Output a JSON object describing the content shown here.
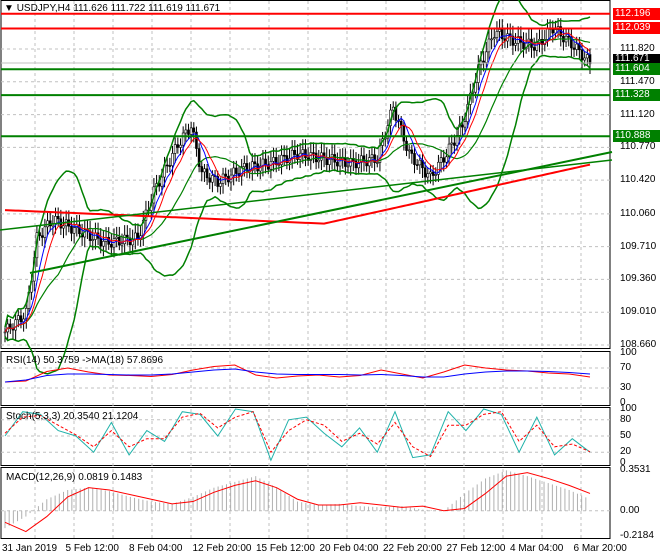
{
  "header": {
    "symbol": "USDJPY,H4",
    "ohlc": "111.626 111.722 111.619 111.671"
  },
  "price_axis": [
    "111.820",
    "111.470",
    "111.120",
    "110.770",
    "110.420",
    "110.060",
    "109.710",
    "109.360",
    "109.010",
    "108.660"
  ],
  "levels": [
    {
      "label": "112.196",
      "value": 112.196,
      "color": "#ff0000"
    },
    {
      "label": "112.039",
      "value": 112.039,
      "color": "#ff0000"
    },
    {
      "label": "111.604",
      "value": 111.604,
      "color": "#008000"
    },
    {
      "label": "111.328",
      "value": 111.328,
      "color": "#008000"
    },
    {
      "label": "110.888",
      "value": 110.888,
      "color": "#008000"
    }
  ],
  "current_price": {
    "label": "111.671",
    "value": 111.671
  },
  "rsi": {
    "title": "RSI(14) 50.3759  ->MA(18) 57.8696",
    "axis": [
      "100",
      "70",
      "30",
      "0"
    ]
  },
  "stoch": {
    "title": "Stoch(5,3,3) 20.3540 21.1204",
    "axis": [
      "100",
      "80",
      "50",
      "20",
      "0"
    ]
  },
  "macd": {
    "title": "MACD(12,26,9) 0.0819 0.1483",
    "axis": [
      "0.3531",
      "0.00",
      "-0.2184"
    ]
  },
  "dates": [
    "31 Jan 2019",
    "5 Feb 12:00",
    "8 Feb 04:00",
    "12 Feb 20:00",
    "15 Feb 12:00",
    "20 Feb 04:00",
    "22 Feb 20:00",
    "27 Feb 12:00",
    "4 Mar 04:00",
    "6 Mar 20:00"
  ],
  "chart_data": {
    "type": "candlestick",
    "price_keypoints": [
      [
        0,
        108.8
      ],
      [
        8,
        109.0
      ],
      [
        12,
        109.8
      ],
      [
        18,
        110.0
      ],
      [
        30,
        109.85
      ],
      [
        38,
        109.75
      ],
      [
        50,
        109.8
      ],
      [
        56,
        110.3
      ],
      [
        65,
        110.8
      ],
      [
        70,
        111.0
      ],
      [
        74,
        110.5
      ],
      [
        80,
        110.4
      ],
      [
        90,
        110.55
      ],
      [
        100,
        110.6
      ],
      [
        110,
        110.7
      ],
      [
        120,
        110.65
      ],
      [
        130,
        110.6
      ],
      [
        140,
        110.65
      ],
      [
        146,
        111.2
      ],
      [
        152,
        110.7
      ],
      [
        160,
        110.45
      ],
      [
        166,
        110.7
      ],
      [
        172,
        111.0
      ],
      [
        178,
        111.6
      ],
      [
        184,
        112.0
      ],
      [
        192,
        111.9
      ],
      [
        200,
        111.85
      ],
      [
        206,
        112.05
      ],
      [
        214,
        111.85
      ],
      [
        220,
        111.671
      ]
    ],
    "rsi": [
      42,
      44,
      63,
      70,
      62,
      56,
      55,
      53,
      57,
      66,
      73,
      76,
      56,
      50,
      54,
      56,
      52,
      55,
      66,
      58,
      50,
      62,
      76,
      70,
      66,
      64,
      60,
      58,
      52
    ],
    "rsi_ma": [
      42,
      46,
      55,
      58,
      58,
      57,
      56,
      56,
      58,
      62,
      66,
      68,
      62,
      58,
      57,
      57,
      57,
      56,
      57,
      55,
      52,
      52,
      58,
      62,
      64,
      64,
      63,
      61,
      58
    ],
    "stoch": [
      50,
      95,
      90,
      60,
      50,
      20,
      75,
      15,
      60,
      40,
      95,
      90,
      50,
      100,
      95,
      5,
      80,
      85,
      55,
      30,
      65,
      20,
      95,
      10,
      15,
      95,
      60,
      100,
      90,
      20,
      85,
      15,
      45,
      20
    ],
    "stoch_signal": [
      55,
      85,
      88,
      70,
      52,
      30,
      60,
      30,
      45,
      45,
      85,
      92,
      65,
      85,
      95,
      20,
      60,
      80,
      70,
      40,
      55,
      35,
      75,
      30,
      12,
      70,
      70,
      90,
      95,
      40,
      70,
      30,
      35,
      21
    ],
    "macd_hist": [
      -0.15,
      -0.05,
      0.1,
      0.18,
      0.2,
      0.17,
      0.12,
      0.08,
      0.06,
      0.12,
      0.2,
      0.25,
      0.3,
      0.2,
      0.08,
      0.05,
      0.06,
      0.04,
      0.03,
      0.04,
      0.01,
      0.0,
      0.15,
      0.28,
      0.35,
      0.3,
      0.24,
      0.18,
      0.1
    ],
    "macd_signal": [
      -0.1,
      -0.18,
      -0.05,
      0.12,
      0.2,
      0.18,
      0.14,
      0.1,
      0.06,
      0.08,
      0.16,
      0.22,
      0.26,
      0.2,
      0.1,
      0.05,
      0.05,
      0.07,
      0.05,
      0.03,
      0.04,
      0.0,
      0.02,
      0.15,
      0.3,
      0.33,
      0.28,
      0.22,
      0.15
    ],
    "ylim": [
      108.66,
      112.3
    ]
  }
}
